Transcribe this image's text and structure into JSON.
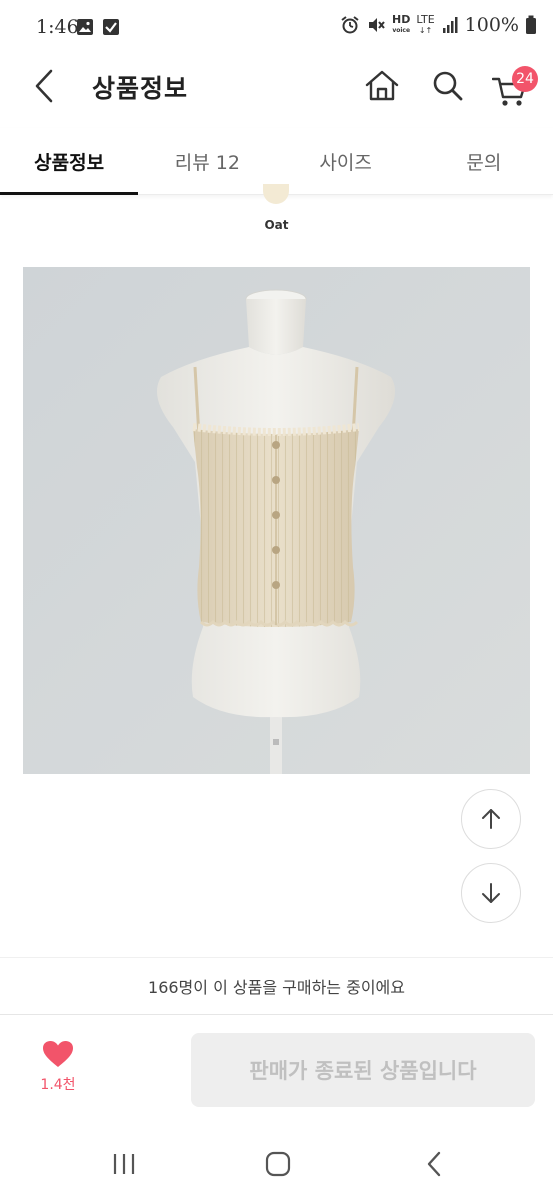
{
  "status_bar": {
    "time": "1:46",
    "network": "LTE",
    "hd": "HD",
    "battery": "100%"
  },
  "header": {
    "title": "상품정보",
    "cart_count": "24"
  },
  "tabs": [
    {
      "label": "상품정보",
      "active": true
    },
    {
      "label": "리뷰 12",
      "active": false
    },
    {
      "label": "사이즈",
      "active": false
    },
    {
      "label": "문의",
      "active": false
    }
  ],
  "color_option": {
    "name": "Oat",
    "swatch_color": "#f3ead4"
  },
  "buyers_text": "166명이 이 상품을 구매하는 중이에요",
  "purchase_bar": {
    "like_count": "1.4천",
    "sold_out_label": "판매가 종료된 상품입니다"
  },
  "colors": {
    "accent": "#f2546a",
    "disabled_bg": "#eeeeee",
    "disabled_text": "#c0c0c0"
  }
}
